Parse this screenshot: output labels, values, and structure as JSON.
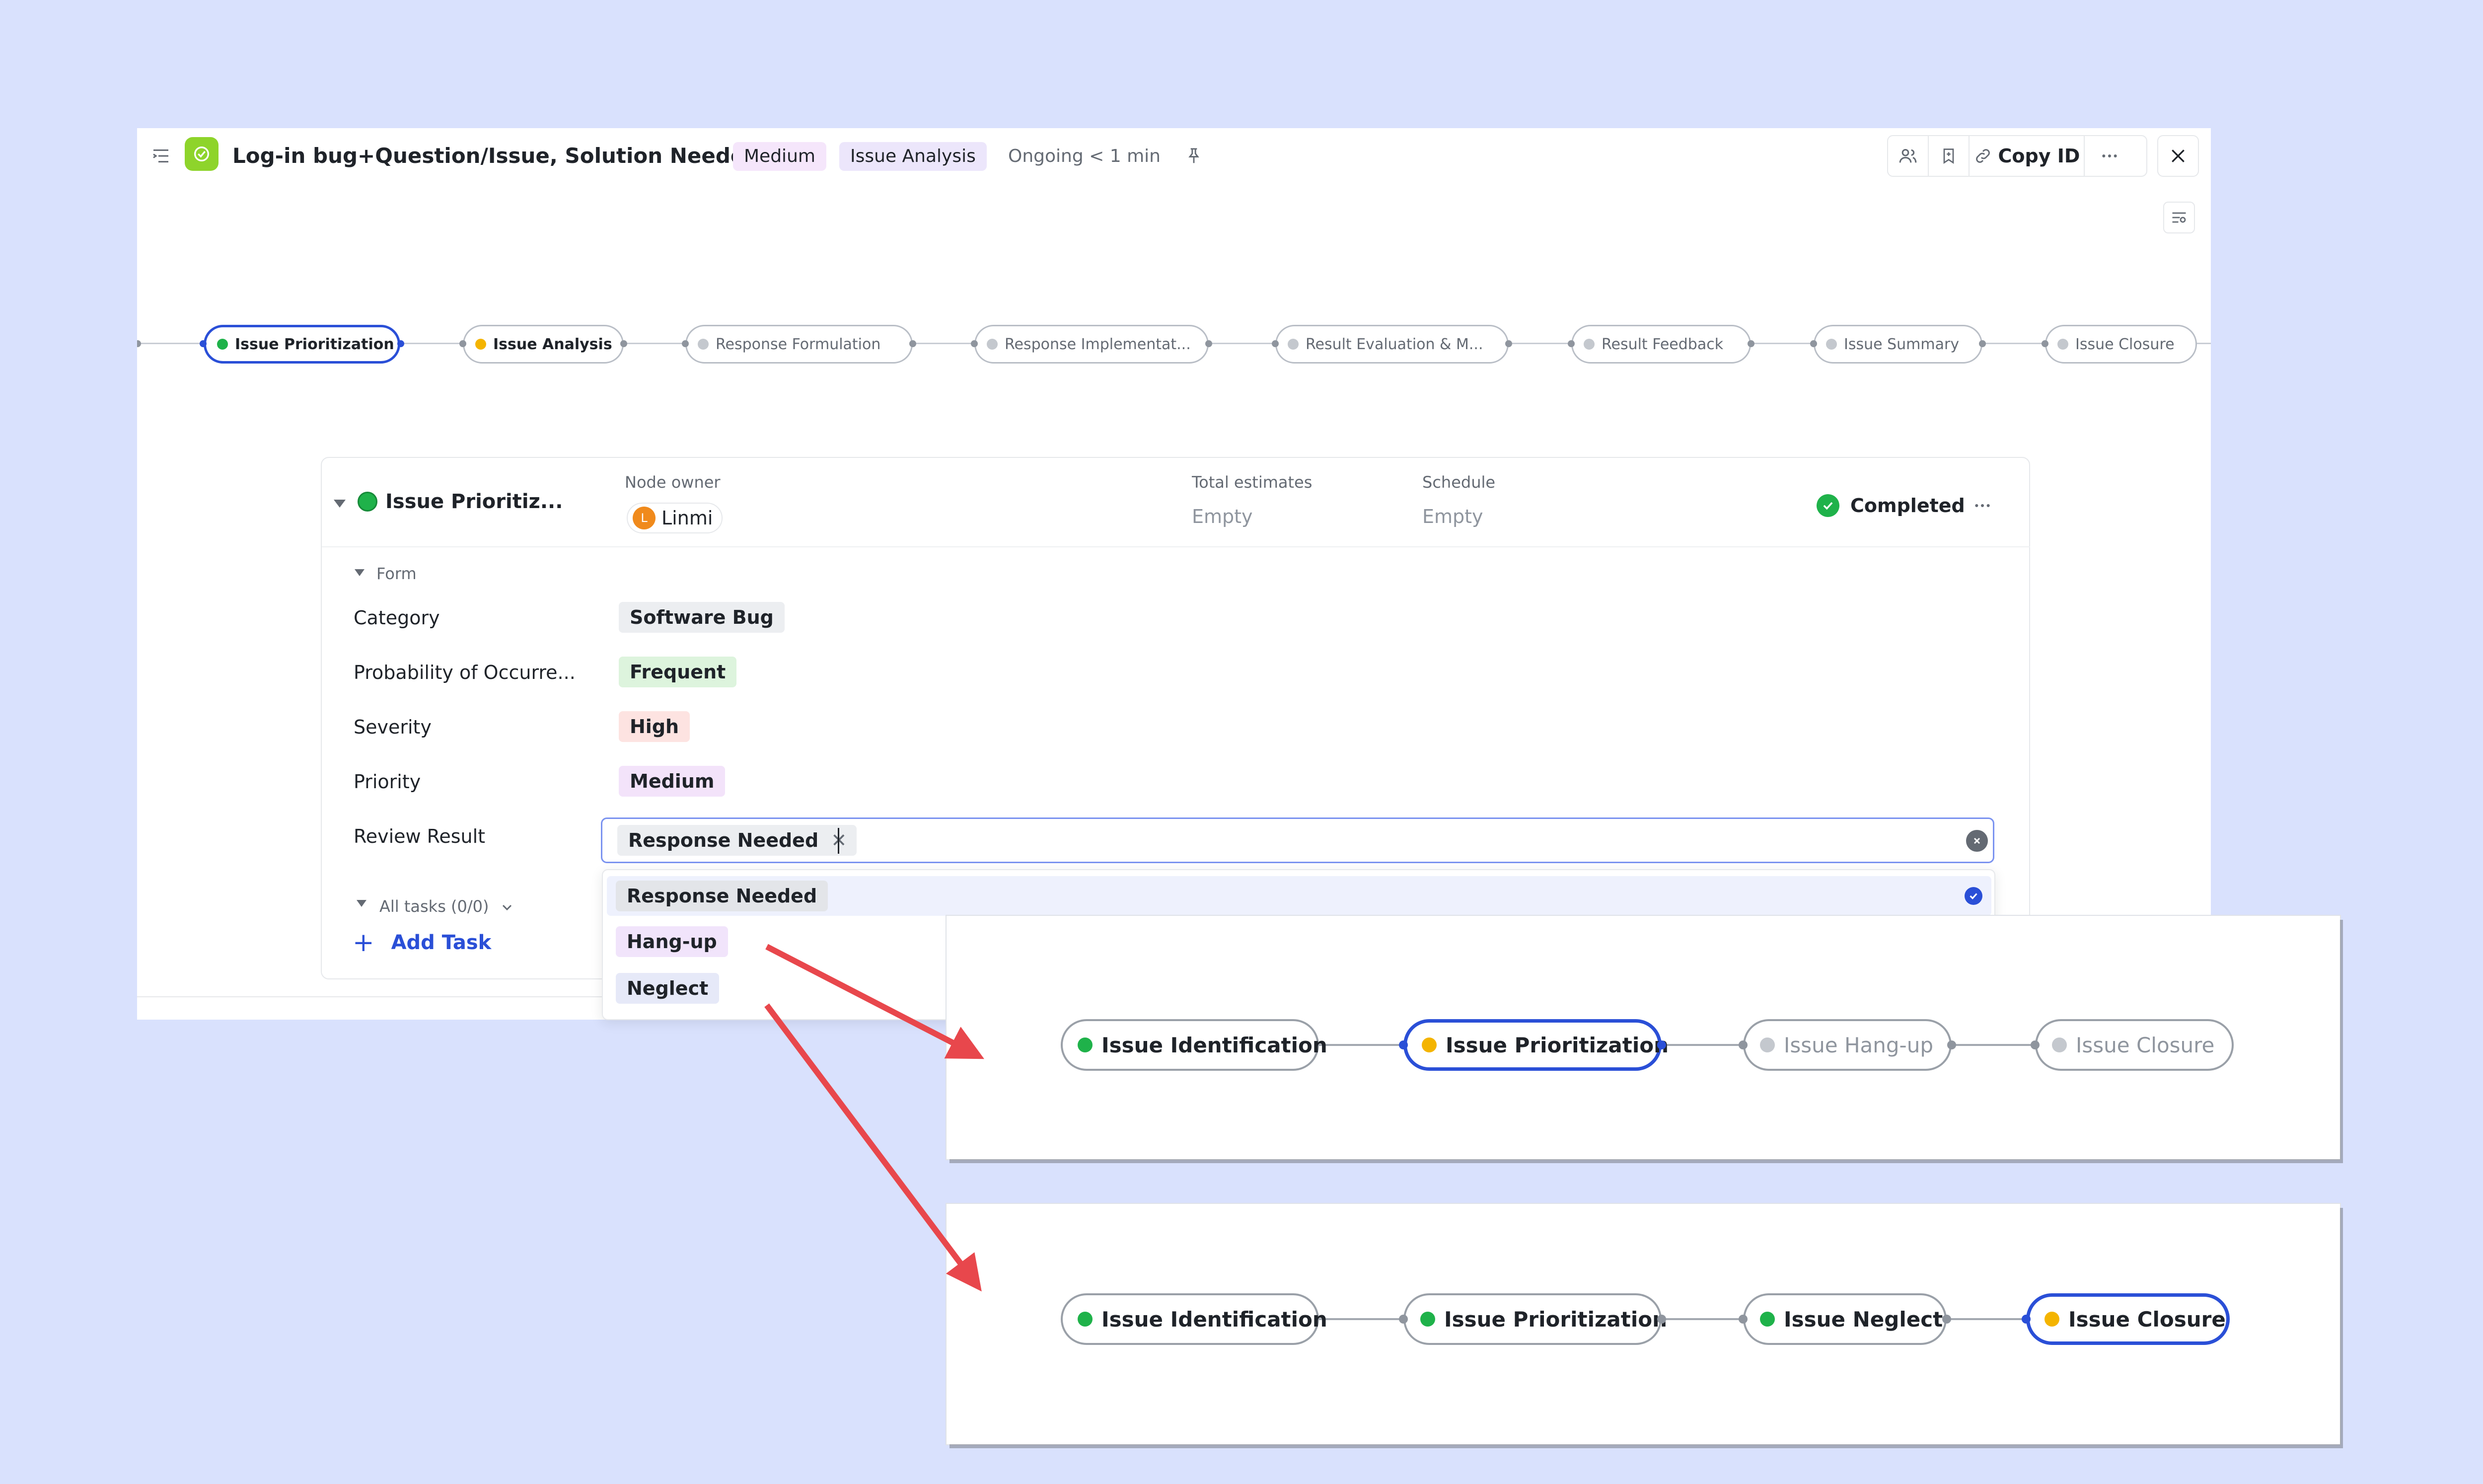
{
  "header": {
    "title": "Log-in bug+Question/Issue, Solution Needed",
    "priority_tag": "Medium",
    "stage_tag": "Issue Analysis",
    "status_text": "Ongoing < 1 min",
    "copy_id_label": "Copy ID"
  },
  "pipeline": {
    "nodes": [
      {
        "label": "Issue Prioritization",
        "status": "green"
      },
      {
        "label": "Issue Analysis",
        "status": "yellow"
      },
      {
        "label": "Response Formulation",
        "status": "gray"
      },
      {
        "label": "Response Implementat...",
        "status": "gray"
      },
      {
        "label": "Result Evaluation & M...",
        "status": "gray"
      },
      {
        "label": "Result Feedback",
        "status": "gray"
      },
      {
        "label": "Issue Summary",
        "status": "gray"
      },
      {
        "label": "Issue Closure",
        "status": "gray"
      }
    ]
  },
  "node_card": {
    "title": "Issue Prioritiz...",
    "owner_label": "Node owner",
    "owner_name": "Linmi",
    "owner_initial": "L",
    "estimates_label": "Total estimates",
    "estimates_value": "Empty",
    "schedule_label": "Schedule",
    "schedule_value": "Empty",
    "status": "Completed",
    "form_label": "Form",
    "fields": [
      {
        "label": "Category",
        "value": "Software Bug"
      },
      {
        "label": "Probability of Occurre...",
        "value": "Frequent"
      },
      {
        "label": "Severity",
        "value": "High"
      },
      {
        "label": "Priority",
        "value": "Medium"
      }
    ],
    "review_label": "Review Result",
    "review_selected": "Response Needed",
    "tasks_label": "All tasks (0/0)",
    "add_task_label": "Add Task"
  },
  "dropdown": {
    "options": [
      "Response Needed",
      "Hang-up",
      "Neglect"
    ],
    "selected": "Response Needed"
  },
  "flow_hangup": {
    "nodes": [
      {
        "label": "Issue Identification",
        "status": "green"
      },
      {
        "label": "Issue Prioritization",
        "status": "yellow"
      },
      {
        "label": "Issue Hang-up",
        "status": "gray"
      },
      {
        "label": "Issue Closure",
        "status": "gray"
      }
    ]
  },
  "flow_neglect": {
    "nodes": [
      {
        "label": "Issue Identification",
        "status": "green"
      },
      {
        "label": "Issue Prioritization",
        "status": "green"
      },
      {
        "label": "Issue Neglect",
        "status": "green"
      },
      {
        "label": "Issue Closure",
        "status": "yellow"
      }
    ]
  },
  "colors": {
    "background": "#d9e1fd",
    "accent_blue": "#2a4fd7",
    "status_green": "#1fb24a",
    "status_yellow": "#f4b400",
    "arrow_red": "#e8474c"
  },
  "icons": [
    "outline-icon",
    "app-logo-icon",
    "pin-icon",
    "members-icon",
    "bookmark-icon",
    "link-icon",
    "more-icon",
    "close-icon",
    "settings-icon",
    "check-icon",
    "caret-down-icon",
    "clear-icon",
    "plus-icon"
  ]
}
